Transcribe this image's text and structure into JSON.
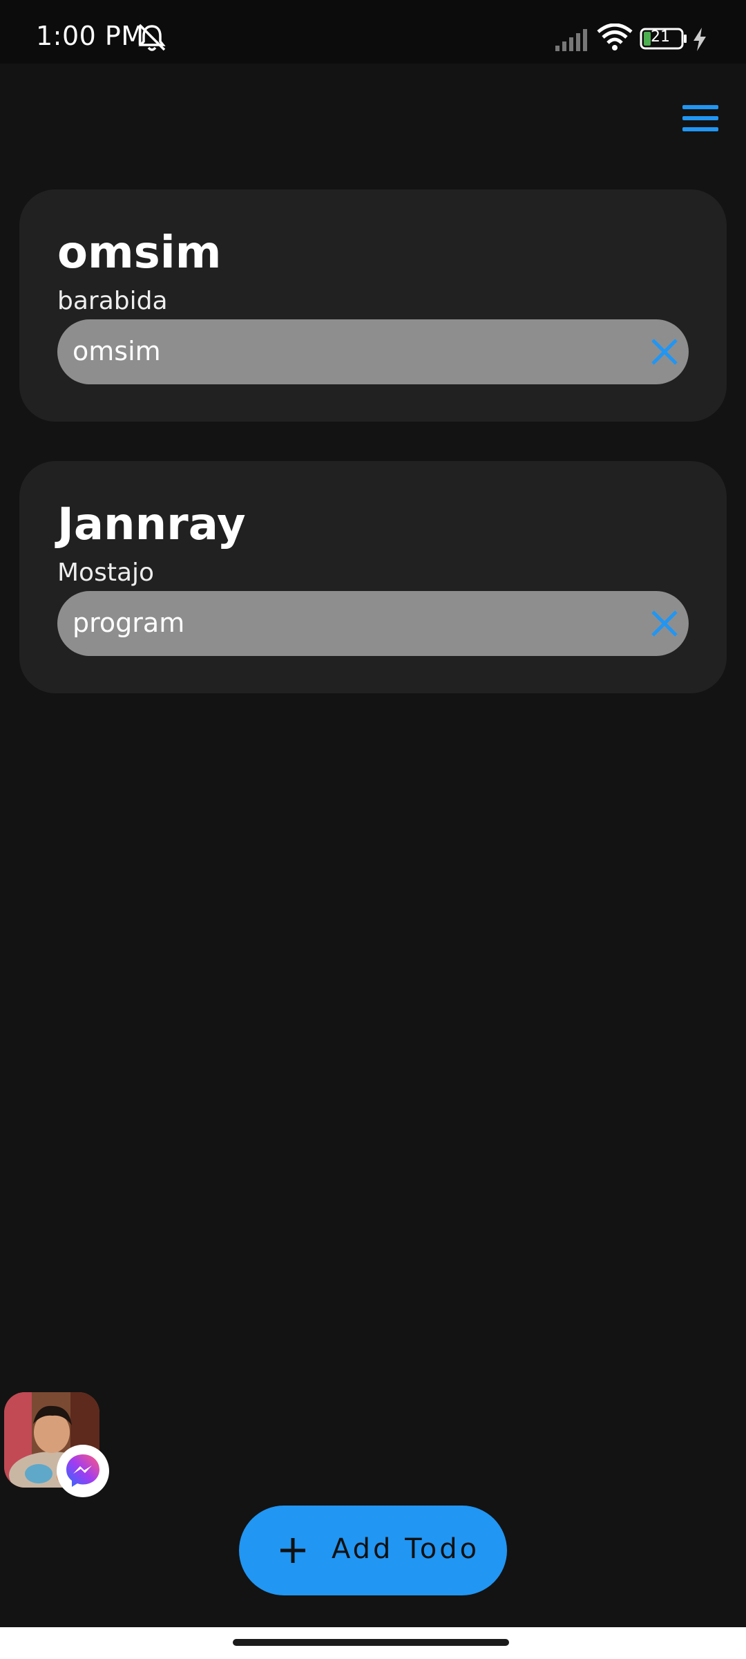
{
  "status_bar": {
    "time": "1:00 PM",
    "battery_level": "21",
    "icons": [
      "mute-bell-icon",
      "signal-icon",
      "wifi-icon",
      "battery-icon",
      "charging-bolt-icon"
    ]
  },
  "app_bar": {
    "menu_icon": "hamburger-menu-icon"
  },
  "todos": [
    {
      "title": "omsim",
      "subtitle": "barabida",
      "task": "omsim",
      "delete_icon": "close-icon"
    },
    {
      "title": "Jannray",
      "subtitle": "Mostajo",
      "task": "program",
      "delete_icon": "close-icon"
    }
  ],
  "chat_head": {
    "badge_icon": "messenger-icon"
  },
  "fab": {
    "label": "Add Todo",
    "icon": "plus-icon"
  },
  "colors": {
    "background": "#131313",
    "card": "#212121",
    "pill": "#8e8e8e",
    "accent": "#2196f3"
  }
}
